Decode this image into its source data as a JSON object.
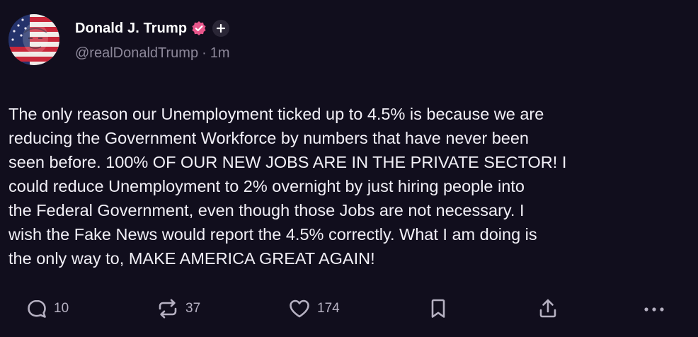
{
  "post": {
    "author": {
      "name": "Donald J. Trump",
      "handle": "@realDonaldTrump",
      "separator": "·",
      "time": "1m",
      "avatar_icon": "avatar-flag-portrait",
      "verified_icon": "verified-badge-icon",
      "verified_color": "#e8568b",
      "plus_icon": "plus-icon"
    },
    "text": "The only reason our Unemployment ticked up to 4.5% is because we are\nreducing the Government Workforce by numbers that have never been\nseen before. 100% OF OUR NEW JOBS ARE IN THE PRIVATE SECTOR! I\ncould reduce Unemployment to 2% overnight by just hiring people into\nthe Federal Government, even though those Jobs are not necessary. I\nwish the Fake News would report the 4.5% correctly. What I am doing is\nthe only way to, MAKE AMERICA GREAT AGAIN!",
    "actions": {
      "reply": {
        "icon": "reply-icon",
        "count": "10"
      },
      "repost": {
        "icon": "repost-icon",
        "count": "37"
      },
      "like": {
        "icon": "heart-icon",
        "count": "174"
      },
      "bookmark": {
        "icon": "bookmark-icon"
      },
      "share": {
        "icon": "share-icon"
      },
      "more": {
        "icon": "more-icon"
      }
    }
  },
  "colors": {
    "background": "#110e1d",
    "text": "#f2f0f7",
    "secondary_text": "#8d889a",
    "icon": "#b6b1c2"
  }
}
